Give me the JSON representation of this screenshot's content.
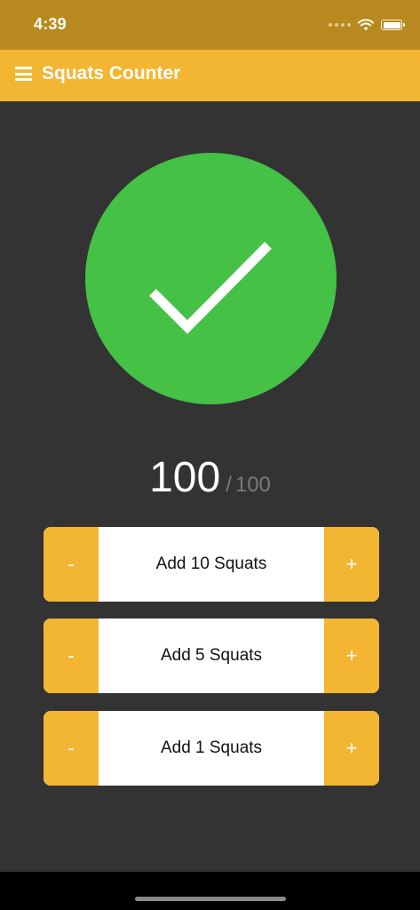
{
  "status_bar": {
    "time": "4:39",
    "battery_level_percent": 100
  },
  "app_bar": {
    "title": "Squats Counter",
    "menu_icon": "hamburger-menu-icon"
  },
  "progress": {
    "icon": "checkmark-icon",
    "count": "100",
    "separator": "/",
    "goal": "100"
  },
  "rows": [
    {
      "label": "Add 10 Squats",
      "minus": "-",
      "plus": "+"
    },
    {
      "label": "Add 5 Squats",
      "minus": "-",
      "plus": "+"
    },
    {
      "label": "Add 1 Squats",
      "minus": "-",
      "plus": "+"
    }
  ],
  "colors": {
    "status_bar": "#B8891F",
    "accent": "#F2B632",
    "background": "#333333",
    "success": "#45C146"
  }
}
